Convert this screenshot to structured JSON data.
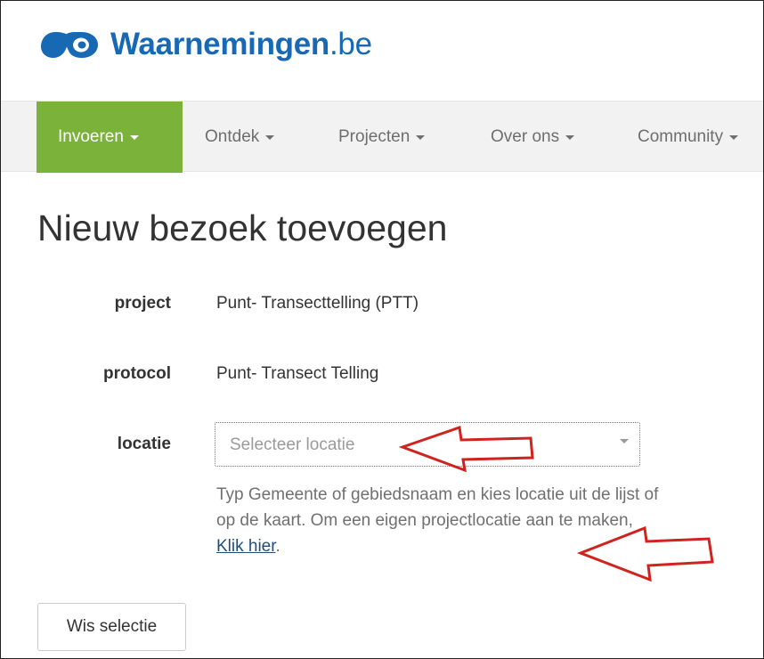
{
  "brand": {
    "name_bold": "Waarnemingen",
    "name_suffix": ".be",
    "primary_color": "#1769b3"
  },
  "nav": {
    "items": [
      {
        "label": "Invoeren",
        "active": true
      },
      {
        "label": "Ontdek",
        "active": false
      },
      {
        "label": "Projecten",
        "active": false
      },
      {
        "label": "Over ons",
        "active": false
      },
      {
        "label": "Community",
        "active": false
      }
    ],
    "active_color": "#7ab23a"
  },
  "page": {
    "title": "Nieuw bezoek toevoegen"
  },
  "form": {
    "project_label": "project",
    "project_value": "Punt- Transecttelling (PTT)",
    "protocol_label": "protocol",
    "protocol_value": "Punt- Transect Telling",
    "locatie_label": "locatie",
    "locatie_placeholder": "Selecteer locatie",
    "help_text_before_link": "Typ Gemeente of gebiedsnaam en kies locatie uit de lijst of op de kaart. Om een eigen projectlocatie aan te maken, ",
    "help_link_label": "Klik hier",
    "help_text_after_link": "."
  },
  "actions": {
    "clear_label": "Wis selectie"
  },
  "annotations": {
    "arrow_color": "#d0231e",
    "arrow_icon": "left-arrow-outline-icon"
  }
}
